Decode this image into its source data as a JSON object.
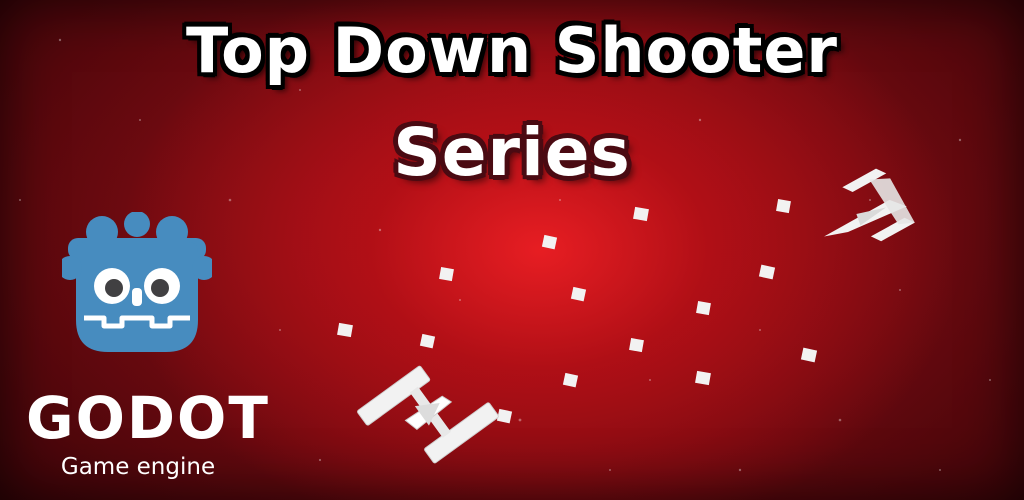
{
  "title": {
    "line1": "Top Down Shooter",
    "line2": "Series"
  },
  "logo": {
    "name": "GODOT",
    "subtitle": "Game engine",
    "icon": "godot-robot-icon",
    "color": "#478cbf"
  },
  "colors": {
    "background": "#a0141b",
    "glow": "#eb1e23",
    "text": "#ffffff",
    "bullet": "#f2f2f2"
  },
  "scene": {
    "player_ship": "white-fighter-ship",
    "enemy_ship": "white-arrow-ship",
    "projectiles": "square-bullets"
  }
}
